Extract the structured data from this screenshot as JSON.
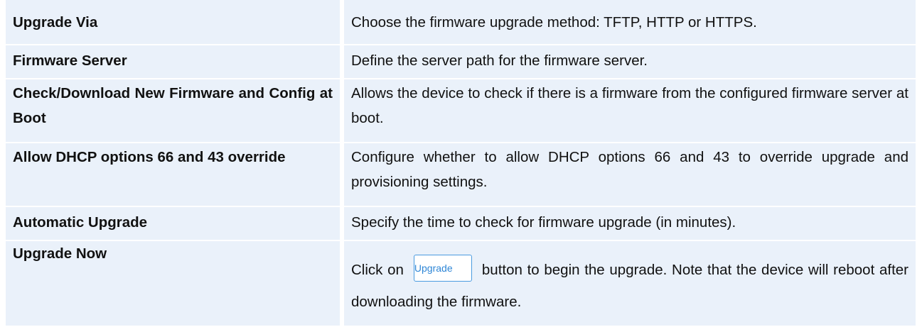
{
  "rows": [
    {
      "label": "Upgrade Via",
      "desc": "Choose the firmware upgrade method: TFTP, HTTP or HTTPS."
    },
    {
      "label": "Firmware Server",
      "desc": "Define the server path for the firmware server."
    },
    {
      "label": "Check/Download New Firmware and Config at Boot",
      "desc": "Allows the device to check if there is a firmware from the configured firmware server at boot."
    },
    {
      "label": "Allow DHCP options 66 and 43 override",
      "desc": "Configure whether to allow DHCP options 66 and 43 to override upgrade and provisioning settings."
    },
    {
      "label": "Automatic Upgrade",
      "desc": "Specify the time to check for firmware upgrade (in minutes)."
    },
    {
      "label": "Upgrade Now",
      "desc_before": "Click on",
      "button_label": "Upgrade",
      "desc_after": "button to begin the upgrade. Note that the device will reboot after downloading the firmware."
    }
  ],
  "colors": {
    "row_background": "#eaf1fa",
    "button_border": "#4a9be0",
    "button_text": "#2e86d6"
  }
}
